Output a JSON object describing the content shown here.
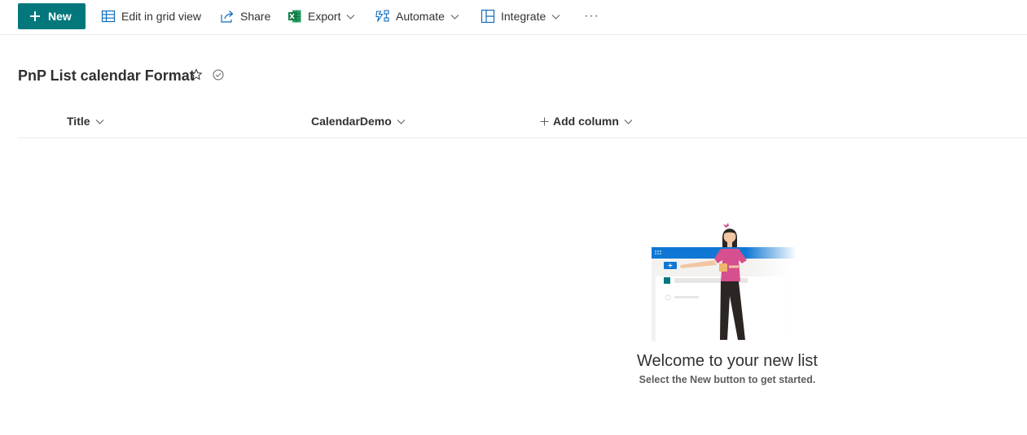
{
  "command_bar": {
    "new_label": "New",
    "edit_grid_label": "Edit in grid view",
    "share_label": "Share",
    "export_label": "Export",
    "automate_label": "Automate",
    "integrate_label": "Integrate",
    "more_label": "···"
  },
  "list": {
    "title": "PnP List calendar Format"
  },
  "columns": {
    "title": "Title",
    "calendar_demo": "CalendarDemo",
    "add_column": "Add column"
  },
  "empty_state": {
    "title": "Welcome to your new list",
    "subtitle": "Select the New button to get started."
  },
  "colors": {
    "accent": "#03787c",
    "excel_green": "#107c41",
    "illustration_blue": "#0f78d4",
    "illustration_pink": "#d64f8e"
  }
}
